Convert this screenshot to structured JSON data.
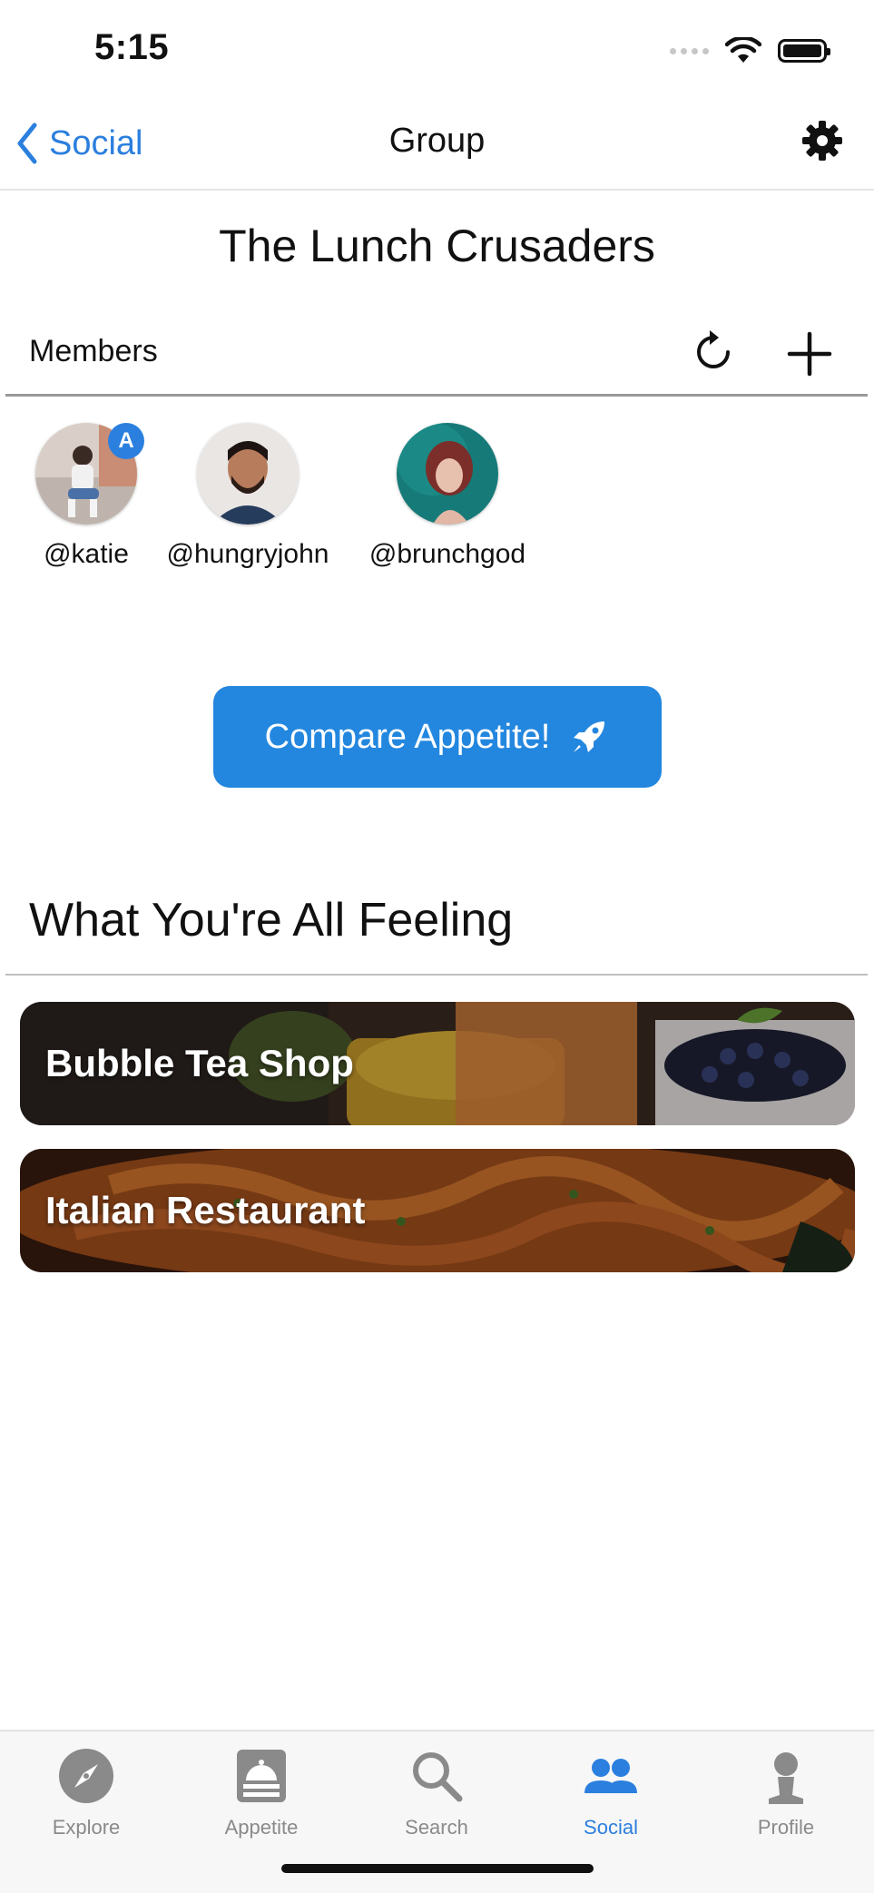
{
  "status_bar": {
    "time": "5:15"
  },
  "nav": {
    "back_label": "Social",
    "title": "Group"
  },
  "group": {
    "name": "The Lunch Crusaders"
  },
  "members_section": {
    "label": "Members",
    "members": [
      {
        "handle": "@katie",
        "admin_badge": "A"
      },
      {
        "handle": "@hungryjohn"
      },
      {
        "handle": "@brunchgod"
      }
    ]
  },
  "compare_button": {
    "label": "Compare Appetite!"
  },
  "feeling_section": {
    "title": "What You're All Feeling",
    "cards": [
      {
        "label": "Bubble Tea Shop"
      },
      {
        "label": "Italian Restaurant"
      }
    ]
  },
  "tabbar": {
    "tabs": [
      {
        "label": "Explore",
        "icon": "compass-icon"
      },
      {
        "label": "Appetite",
        "icon": "food-tray-icon"
      },
      {
        "label": "Search",
        "icon": "search-icon"
      },
      {
        "label": "Social",
        "icon": "people-icon",
        "active": true
      },
      {
        "label": "Profile",
        "icon": "person-icon"
      }
    ]
  },
  "colors": {
    "accent": "#2b7fde",
    "button": "#2387df",
    "inactive_tab": "#8a8a8a"
  }
}
